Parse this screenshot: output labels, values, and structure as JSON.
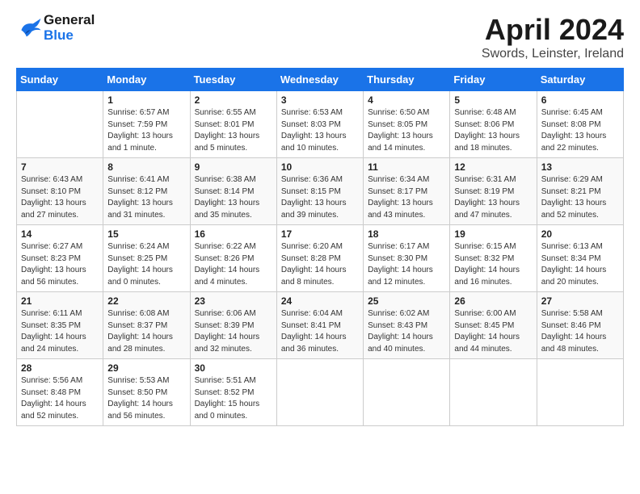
{
  "header": {
    "logo_line1": "General",
    "logo_line2": "Blue",
    "title": "April 2024",
    "subtitle": "Swords, Leinster, Ireland"
  },
  "weekdays": [
    "Sunday",
    "Monday",
    "Tuesday",
    "Wednesday",
    "Thursday",
    "Friday",
    "Saturday"
  ],
  "weeks": [
    [
      {
        "day": "",
        "sunrise": "",
        "sunset": "",
        "daylight": ""
      },
      {
        "day": "1",
        "sunrise": "Sunrise: 6:57 AM",
        "sunset": "Sunset: 7:59 PM",
        "daylight": "Daylight: 13 hours and 1 minute."
      },
      {
        "day": "2",
        "sunrise": "Sunrise: 6:55 AM",
        "sunset": "Sunset: 8:01 PM",
        "daylight": "Daylight: 13 hours and 5 minutes."
      },
      {
        "day": "3",
        "sunrise": "Sunrise: 6:53 AM",
        "sunset": "Sunset: 8:03 PM",
        "daylight": "Daylight: 13 hours and 10 minutes."
      },
      {
        "day": "4",
        "sunrise": "Sunrise: 6:50 AM",
        "sunset": "Sunset: 8:05 PM",
        "daylight": "Daylight: 13 hours and 14 minutes."
      },
      {
        "day": "5",
        "sunrise": "Sunrise: 6:48 AM",
        "sunset": "Sunset: 8:06 PM",
        "daylight": "Daylight: 13 hours and 18 minutes."
      },
      {
        "day": "6",
        "sunrise": "Sunrise: 6:45 AM",
        "sunset": "Sunset: 8:08 PM",
        "daylight": "Daylight: 13 hours and 22 minutes."
      }
    ],
    [
      {
        "day": "7",
        "sunrise": "Sunrise: 6:43 AM",
        "sunset": "Sunset: 8:10 PM",
        "daylight": "Daylight: 13 hours and 27 minutes."
      },
      {
        "day": "8",
        "sunrise": "Sunrise: 6:41 AM",
        "sunset": "Sunset: 8:12 PM",
        "daylight": "Daylight: 13 hours and 31 minutes."
      },
      {
        "day": "9",
        "sunrise": "Sunrise: 6:38 AM",
        "sunset": "Sunset: 8:14 PM",
        "daylight": "Daylight: 13 hours and 35 minutes."
      },
      {
        "day": "10",
        "sunrise": "Sunrise: 6:36 AM",
        "sunset": "Sunset: 8:15 PM",
        "daylight": "Daylight: 13 hours and 39 minutes."
      },
      {
        "day": "11",
        "sunrise": "Sunrise: 6:34 AM",
        "sunset": "Sunset: 8:17 PM",
        "daylight": "Daylight: 13 hours and 43 minutes."
      },
      {
        "day": "12",
        "sunrise": "Sunrise: 6:31 AM",
        "sunset": "Sunset: 8:19 PM",
        "daylight": "Daylight: 13 hours and 47 minutes."
      },
      {
        "day": "13",
        "sunrise": "Sunrise: 6:29 AM",
        "sunset": "Sunset: 8:21 PM",
        "daylight": "Daylight: 13 hours and 52 minutes."
      }
    ],
    [
      {
        "day": "14",
        "sunrise": "Sunrise: 6:27 AM",
        "sunset": "Sunset: 8:23 PM",
        "daylight": "Daylight: 13 hours and 56 minutes."
      },
      {
        "day": "15",
        "sunrise": "Sunrise: 6:24 AM",
        "sunset": "Sunset: 8:25 PM",
        "daylight": "Daylight: 14 hours and 0 minutes."
      },
      {
        "day": "16",
        "sunrise": "Sunrise: 6:22 AM",
        "sunset": "Sunset: 8:26 PM",
        "daylight": "Daylight: 14 hours and 4 minutes."
      },
      {
        "day": "17",
        "sunrise": "Sunrise: 6:20 AM",
        "sunset": "Sunset: 8:28 PM",
        "daylight": "Daylight: 14 hours and 8 minutes."
      },
      {
        "day": "18",
        "sunrise": "Sunrise: 6:17 AM",
        "sunset": "Sunset: 8:30 PM",
        "daylight": "Daylight: 14 hours and 12 minutes."
      },
      {
        "day": "19",
        "sunrise": "Sunrise: 6:15 AM",
        "sunset": "Sunset: 8:32 PM",
        "daylight": "Daylight: 14 hours and 16 minutes."
      },
      {
        "day": "20",
        "sunrise": "Sunrise: 6:13 AM",
        "sunset": "Sunset: 8:34 PM",
        "daylight": "Daylight: 14 hours and 20 minutes."
      }
    ],
    [
      {
        "day": "21",
        "sunrise": "Sunrise: 6:11 AM",
        "sunset": "Sunset: 8:35 PM",
        "daylight": "Daylight: 14 hours and 24 minutes."
      },
      {
        "day": "22",
        "sunrise": "Sunrise: 6:08 AM",
        "sunset": "Sunset: 8:37 PM",
        "daylight": "Daylight: 14 hours and 28 minutes."
      },
      {
        "day": "23",
        "sunrise": "Sunrise: 6:06 AM",
        "sunset": "Sunset: 8:39 PM",
        "daylight": "Daylight: 14 hours and 32 minutes."
      },
      {
        "day": "24",
        "sunrise": "Sunrise: 6:04 AM",
        "sunset": "Sunset: 8:41 PM",
        "daylight": "Daylight: 14 hours and 36 minutes."
      },
      {
        "day": "25",
        "sunrise": "Sunrise: 6:02 AM",
        "sunset": "Sunset: 8:43 PM",
        "daylight": "Daylight: 14 hours and 40 minutes."
      },
      {
        "day": "26",
        "sunrise": "Sunrise: 6:00 AM",
        "sunset": "Sunset: 8:45 PM",
        "daylight": "Daylight: 14 hours and 44 minutes."
      },
      {
        "day": "27",
        "sunrise": "Sunrise: 5:58 AM",
        "sunset": "Sunset: 8:46 PM",
        "daylight": "Daylight: 14 hours and 48 minutes."
      }
    ],
    [
      {
        "day": "28",
        "sunrise": "Sunrise: 5:56 AM",
        "sunset": "Sunset: 8:48 PM",
        "daylight": "Daylight: 14 hours and 52 minutes."
      },
      {
        "day": "29",
        "sunrise": "Sunrise: 5:53 AM",
        "sunset": "Sunset: 8:50 PM",
        "daylight": "Daylight: 14 hours and 56 minutes."
      },
      {
        "day": "30",
        "sunrise": "Sunrise: 5:51 AM",
        "sunset": "Sunset: 8:52 PM",
        "daylight": "Daylight: 15 hours and 0 minutes."
      },
      {
        "day": "",
        "sunrise": "",
        "sunset": "",
        "daylight": ""
      },
      {
        "day": "",
        "sunrise": "",
        "sunset": "",
        "daylight": ""
      },
      {
        "day": "",
        "sunrise": "",
        "sunset": "",
        "daylight": ""
      },
      {
        "day": "",
        "sunrise": "",
        "sunset": "",
        "daylight": ""
      }
    ]
  ]
}
